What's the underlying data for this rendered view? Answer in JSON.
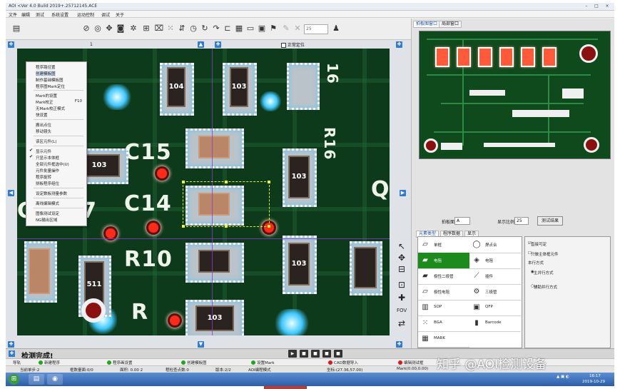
{
  "window": {
    "title": "AOI      <Ver 4.0 Build 2019+.25712145.ACE",
    "buttons": [
      "–",
      "□",
      "×"
    ]
  },
  "menubar": [
    "文件",
    "编辑",
    "测试",
    "系统设置",
    "运动控制",
    "调试",
    "关于"
  ],
  "toolbar": {
    "zoom_value": "25",
    "icons": [
      "open-icon",
      "save-icon",
      "stop-icon",
      "target-icon",
      "camera-icon",
      "grid-icon",
      "pan-icon",
      "hand-icon",
      "refresh-icon",
      "undo-icon",
      "redo-icon",
      "crop-icon",
      "zoom-icon",
      "layers-icon",
      "folder-icon",
      "flag-icon",
      "edit-icon",
      "disabled-icon",
      "user-icon"
    ]
  },
  "pcb_view": {
    "checkbox_label": "正常定位",
    "ruler_number": "1",
    "silkscreen": [
      {
        "text": "C15"
      },
      {
        "text": "C14"
      },
      {
        "text": "R10"
      },
      {
        "text": "C9"
      },
      {
        "text": "R7"
      },
      {
        "text": "R16"
      },
      {
        "text": "R"
      },
      {
        "text": "16"
      },
      {
        "text": "Q"
      }
    ],
    "chip_labels": [
      "104",
      "103",
      "103",
      "103",
      "103",
      "511",
      "103"
    ]
  },
  "context_menu": {
    "items": [
      {
        "label": "程序路径置",
        "shortcut": "",
        "checked": false
      },
      {
        "label": "创建模板图",
        "shortcut": "",
        "checked": false
      },
      {
        "label": "制作基础模板图",
        "shortcut": "",
        "checked": false
      },
      {
        "label": "程序图Mark定位",
        "shortcut": "",
        "checked": false
      },
      {
        "label": "Mark的设置",
        "shortcut": "",
        "checked": false
      },
      {
        "label": "Mark校正",
        "shortcut": "F10",
        "checked": false
      },
      {
        "label": "无Mark校正模式",
        "shortcut": "",
        "checked": false
      },
      {
        "label": "快设置",
        "shortcut": "",
        "checked": false
      },
      {
        "label": "搬出点位",
        "shortcut": "",
        "checked": false
      },
      {
        "label": "移动镜头",
        "shortcut": "",
        "checked": false
      },
      {
        "label": "该区元件(L)",
        "shortcut": "",
        "checked": false
      },
      {
        "label": "显示元件",
        "shortcut": "",
        "checked": true
      },
      {
        "label": "只显示本体框",
        "shortcut": "",
        "checked": true
      },
      {
        "label": "全部元件框选中(U)",
        "shortcut": "",
        "checked": false
      },
      {
        "label": "元件批量操作",
        "shortcut": "",
        "checked": false
      },
      {
        "label": "程序旋转",
        "shortcut": "",
        "checked": false
      },
      {
        "label": "拼板程序组位",
        "shortcut": "",
        "checked": false
      },
      {
        "label": "设定数板测量参数",
        "shortcut": "",
        "checked": false
      },
      {
        "label": "离线编辑模式",
        "shortcut": "",
        "checked": false
      },
      {
        "label": "图像测试设定",
        "shortcut": "",
        "checked": false
      },
      {
        "label": "NG输出区域",
        "shortcut": "",
        "checked": false
      }
    ]
  },
  "right_panel": {
    "tabs": [
      "拍板图窗口",
      "局部窗口"
    ],
    "form": {
      "board_label": "拍板面:",
      "board_value": "A",
      "ratio_label": "显示比例:",
      "ratio_value": "25",
      "test_button": "测试结果"
    },
    "lib_tabs": [
      "元素类型",
      "程序数据",
      "显示"
    ],
    "components": [
      {
        "label": "单框",
        "icon": "single-box-icon",
        "selected": false
      },
      {
        "label": "焊点合",
        "icon": "solder-icon",
        "selected": false
      },
      {
        "label": "电阻",
        "icon": "resistor-icon",
        "selected": true
      },
      {
        "label": "电阻",
        "icon": "capacitor-icon",
        "selected": false
      },
      {
        "label": "极性二极管",
        "icon": "diode-icon",
        "selected": false
      },
      {
        "label": "插件",
        "icon": "plugin-icon",
        "selected": false
      },
      {
        "label": "极性电阻",
        "icon": "polar-resistor-icon",
        "selected": false
      },
      {
        "label": "三极管",
        "icon": "transistor-icon",
        "selected": false
      },
      {
        "label": "SOP",
        "icon": "sop-icon",
        "selected": false
      },
      {
        "label": "QFP",
        "icon": "qfp-icon",
        "selected": false
      },
      {
        "label": "BGA",
        "icon": "bga-icon",
        "selected": false
      },
      {
        "label": "Barcode",
        "icon": "barcode-icon",
        "selected": false
      },
      {
        "label": "MARK",
        "icon": "mark-icon",
        "selected": false
      }
    ],
    "options": {
      "check1": "直接可定",
      "check2": "只做主体框元件",
      "section": "本行方式",
      "radio1": "主并行方式",
      "radio2": "辅助并行方式"
    }
  },
  "bottom_bar": {
    "status": "检测完成!",
    "play_buttons": [
      "▶",
      "■",
      "■",
      "■",
      "■"
    ]
  },
  "flow_steps": [
    {
      "label": "导轨",
      "color": ""
    },
    {
      "label": "新建程序",
      "color": "#1ea81e"
    },
    {
      "label": "程序画设置",
      "color": "#1ea81e"
    },
    {
      "label": "创建模板图",
      "color": "#1ea81e"
    },
    {
      "label": "设置Mark",
      "color": "#1ea81e"
    },
    {
      "label": "CAD数据导入",
      "color": "#d81b1b"
    },
    {
      "label": "编辑测试框",
      "color": "#d81b1b"
    }
  ],
  "info_bar": [
    "当前单步:2",
    "框数量面:0/0",
    "面积: 0.00 2",
    "程检查点数:0",
    "版本:2/2",
    "AOI编程模式",
    "坐标:(27.36,57.00)",
    "Mark(0.00,0.00)"
  ],
  "taskbar": {
    "time": "16:17",
    "date": "2019-10-29"
  },
  "watermark": "知乎 @AOI检测设备"
}
